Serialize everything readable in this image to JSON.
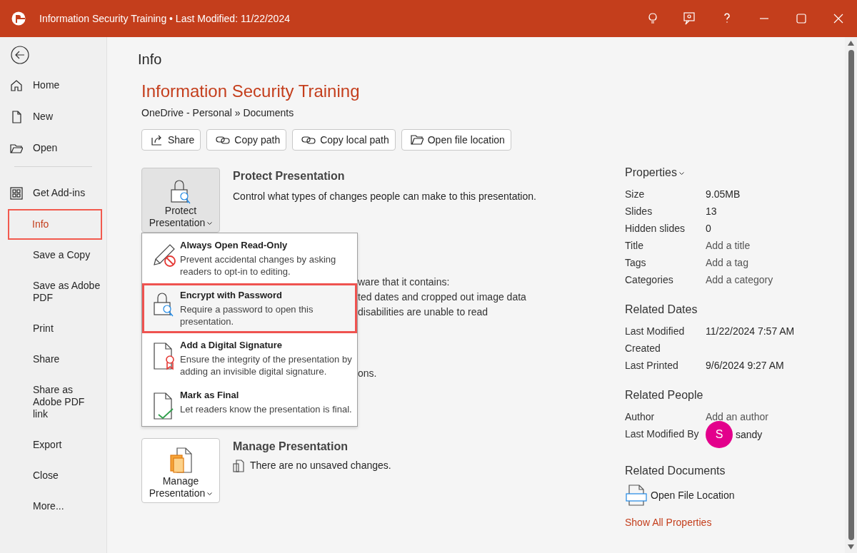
{
  "window": {
    "title": "Information Security Training • Last Modified: 11/22/2024"
  },
  "sidebar": {
    "items": [
      {
        "kind": "nav",
        "label": "Home",
        "selected": false
      },
      {
        "kind": "nav",
        "label": "New",
        "selected": false
      },
      {
        "kind": "nav",
        "label": "Open",
        "selected": false
      },
      {
        "kind": "divider"
      },
      {
        "kind": "nav",
        "label": "Get Add-ins",
        "selected": false
      },
      {
        "kind": "nav",
        "label": "Info",
        "selected": true
      },
      {
        "kind": "nav",
        "label": "Save a Copy",
        "selected": false
      },
      {
        "kind": "nav",
        "label": "Save as Adobe PDF",
        "selected": false
      },
      {
        "kind": "nav",
        "label": "Print",
        "selected": false
      },
      {
        "kind": "nav",
        "label": "Share",
        "selected": false
      },
      {
        "kind": "nav",
        "label": "Share as Adobe PDF link",
        "selected": false
      },
      {
        "kind": "nav",
        "label": "Export",
        "selected": false
      },
      {
        "kind": "nav",
        "label": "Close",
        "selected": false
      },
      {
        "kind": "nav",
        "label": "More...",
        "selected": false
      }
    ]
  },
  "page": {
    "heading": "Info",
    "file_title": "Information Security Training",
    "path": "OneDrive - Personal » Documents",
    "actions": [
      {
        "label": "Share"
      },
      {
        "label": "Copy path"
      },
      {
        "label": "Copy local path"
      },
      {
        "label": "Open file location"
      }
    ]
  },
  "sections": [
    {
      "button_label": "Protect Presentation",
      "expanded": true,
      "title": "Protect Presentation",
      "description": "Control what types of changes people can make to this presentation."
    },
    {
      "button_label": "Manage Presentation",
      "expanded": false,
      "title": "Manage Presentation",
      "description": "There are no unsaved changes."
    }
  ],
  "covered_section": {
    "lines": [
      "ware that it contains:",
      "ted dates and cropped out image data",
      "disabilities are unable to read",
      "ons."
    ]
  },
  "menu": {
    "items": [
      {
        "title": "Always Open Read-Only",
        "description": "Prevent accidental changes by asking readers to opt-in to editing.",
        "selected": false
      },
      {
        "title": "Encrypt with Password",
        "description": "Require a password to open this presentation.",
        "selected": true
      },
      {
        "title": "Add a Digital Signature",
        "description": "Ensure the integrity of the presentation by adding an invisible digital signature.",
        "selected": false
      },
      {
        "title": "Mark as Final",
        "description": "Let readers know the presentation is final.",
        "selected": false
      }
    ]
  },
  "properties": {
    "heading": "Properties",
    "rows": [
      {
        "label": "Size",
        "value": "9.05MB",
        "kind": "text"
      },
      {
        "label": "Slides",
        "value": "13",
        "kind": "text"
      },
      {
        "label": "Hidden slides",
        "value": "0",
        "kind": "text"
      },
      {
        "label": "Title",
        "value": "Add a title",
        "kind": "placeholder"
      },
      {
        "label": "Tags",
        "value": "Add a tag",
        "kind": "placeholder"
      },
      {
        "label": "Categories",
        "value": "Add a category",
        "kind": "placeholder"
      }
    ]
  },
  "related_dates": {
    "heading": "Related Dates",
    "rows": [
      {
        "label": "Last Modified",
        "value": "11/22/2024 7:57 AM"
      },
      {
        "label": "Created"
      },
      {
        "label": "Last Printed",
        "value": "9/6/2024 9:27 AM"
      }
    ]
  },
  "related_people": {
    "heading": "Related People",
    "rows": [
      {
        "label": "Author",
        "value": "Add an author",
        "kind": "placeholder"
      },
      {
        "label": "Last Modified By",
        "value": "sandy",
        "kind": "person",
        "initial": "S",
        "color": "#e3008c"
      }
    ]
  },
  "related_documents": {
    "heading": "Related Documents",
    "items": [
      {
        "label": "Open File Location"
      }
    ]
  },
  "show_all": "Show All Properties"
}
